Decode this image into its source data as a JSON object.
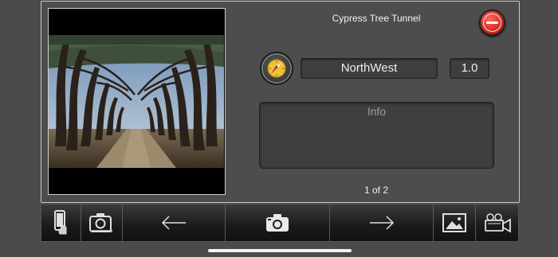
{
  "photo": {
    "subject": "cypress tree tunnel photograph"
  },
  "header": {
    "title": "Cypress Tree Tunnel"
  },
  "direction": {
    "value": "NorthWest",
    "multiplier": "1.0"
  },
  "info": {
    "label": "Info"
  },
  "pager": {
    "text": "1 of 2"
  },
  "toolbar": {
    "buttons": [
      {
        "name": "device-rotate-icon"
      },
      {
        "name": "camera-switch-icon"
      },
      {
        "name": "arrow-left-icon"
      },
      {
        "name": "camera-icon"
      },
      {
        "name": "arrow-right-icon"
      },
      {
        "name": "gallery-icon"
      },
      {
        "name": "video-camera-icon"
      }
    ]
  },
  "colors": {
    "close": "#d3261b",
    "panel": "#4d4d4d",
    "field": "#3e3e3e",
    "toolbar": "#1a1a1a"
  }
}
